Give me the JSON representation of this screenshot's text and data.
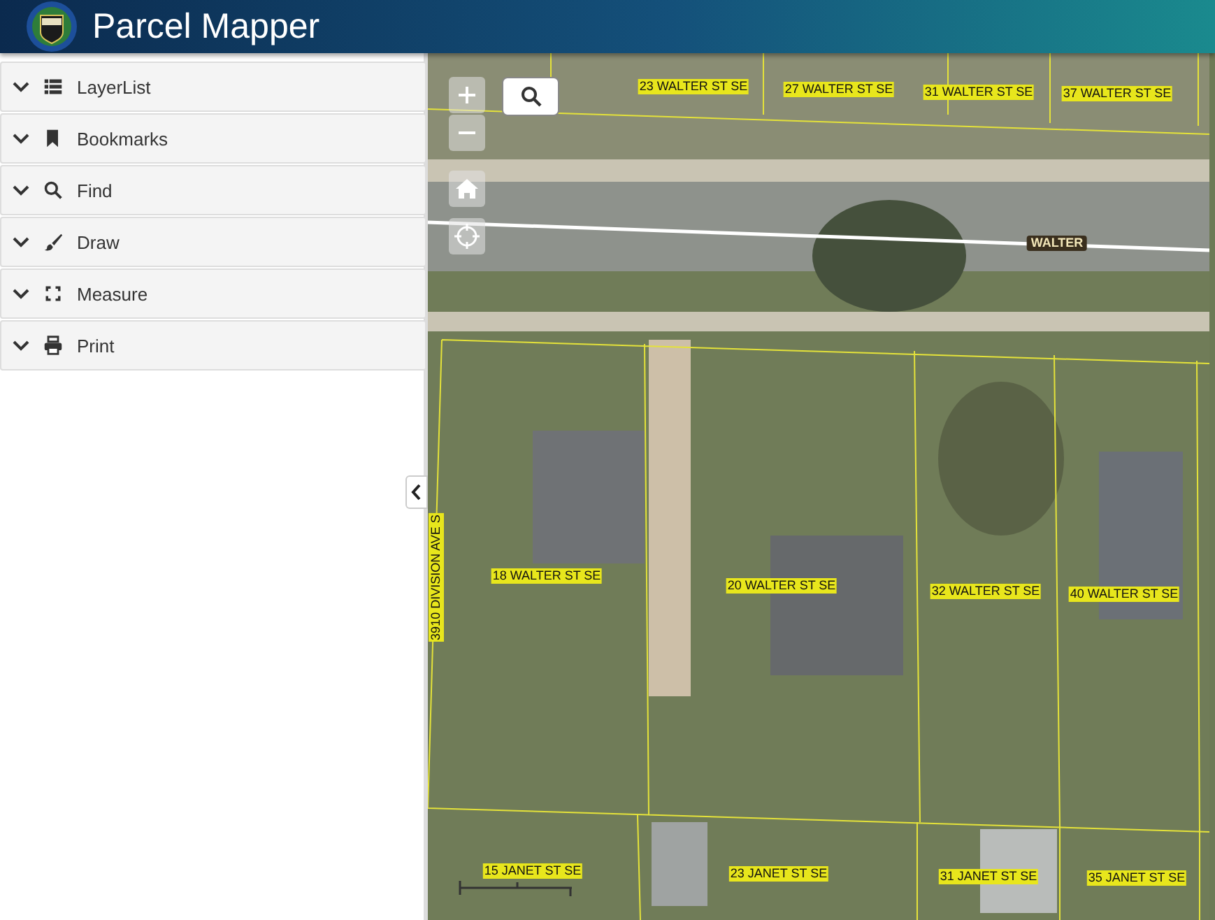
{
  "header": {
    "title": "Parcel Mapper"
  },
  "sidebar": {
    "panels": [
      {
        "label": "LayerList",
        "kind": "list",
        "expanded": false
      },
      {
        "label": "Bookmarks",
        "kind": "bookmark",
        "expanded": false
      },
      {
        "label": "Find",
        "kind": "search",
        "expanded": false
      },
      {
        "label": "Draw",
        "kind": "brush",
        "expanded": false
      },
      {
        "label": "Measure",
        "kind": "measure",
        "expanded": false
      },
      {
        "label": "Print",
        "kind": "print",
        "expanded": false
      }
    ]
  },
  "map": {
    "labels": [
      {
        "text": "23 WALTER ST SE",
        "kind": "parcel"
      },
      {
        "text": "27 WALTER ST SE",
        "kind": "parcel"
      },
      {
        "text": "31 WALTER ST SE",
        "kind": "parcel"
      },
      {
        "text": "37 WALTER ST SE",
        "kind": "parcel"
      },
      {
        "text": "WALTER",
        "kind": "street"
      },
      {
        "text": "3910 DIVISION AVE S",
        "kind": "vertical"
      },
      {
        "text": "18 WALTER ST SE",
        "kind": "parcel"
      },
      {
        "text": "20 WALTER ST SE",
        "kind": "parcel"
      },
      {
        "text": "32 WALTER ST SE",
        "kind": "parcel"
      },
      {
        "text": "40 WALTER ST SE",
        "kind": "parcel"
      },
      {
        "text": "15 JANET ST SE",
        "kind": "parcel"
      },
      {
        "text": "23 JANET ST SE",
        "kind": "parcel"
      },
      {
        "text": "31 JANET ST SE",
        "kind": "parcel"
      },
      {
        "text": "35 JANET ST SE",
        "kind": "parcel"
      }
    ]
  }
}
